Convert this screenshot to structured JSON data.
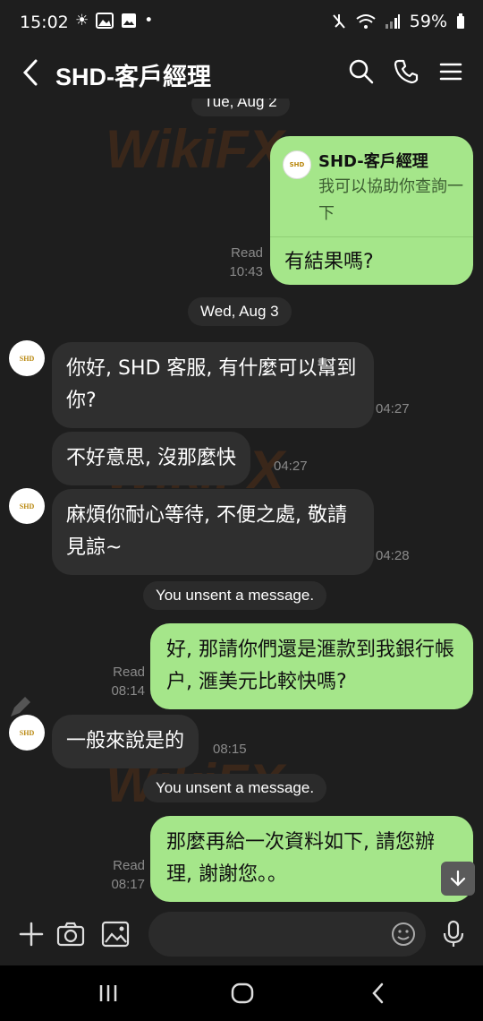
{
  "status_bar": {
    "time": "15:02",
    "battery": "59%"
  },
  "header": {
    "title": "SHD-客戶經理"
  },
  "chat": {
    "date_1": "Tue, Aug 2",
    "reply_card": {
      "quote_sender": "SHD-客戶經理",
      "quote_text": "我可以協助你查詢一下",
      "text": "有結果嗎?",
      "read": "Read",
      "time": "10:43"
    },
    "date_2": "Wed, Aug 3",
    "avatar_label": "SHD",
    "msg1": {
      "text": "你好, SHD 客服, 有什麼可以幫到你?",
      "time": "04:27"
    },
    "msg2": {
      "text": "不好意思, 沒那麼快",
      "time": "04:27"
    },
    "msg3": {
      "text": "麻煩你耐心等待, 不便之處, 敬請見諒~",
      "time": "04:28"
    },
    "system_1": "You unsent a message.",
    "msg4": {
      "text": "好, 那請你們還是滙款到我銀行帳户, 滙美元比較快嗎?",
      "read": "Read",
      "time": "08:14"
    },
    "msg5": {
      "text": "一般來說是的",
      "time": "08:15"
    },
    "system_2": "You unsent a message.",
    "msg6": {
      "text": "那麼再給一次資料如下, 請您辦理, 謝謝您。。",
      "read": "Read",
      "time": "08:17"
    }
  },
  "watermark": "WikiFX",
  "input": {
    "placeholder": ""
  },
  "colors": {
    "outgoing": "#a5e68a",
    "incoming": "#2f2f2f",
    "background": "#1e1e1e"
  }
}
